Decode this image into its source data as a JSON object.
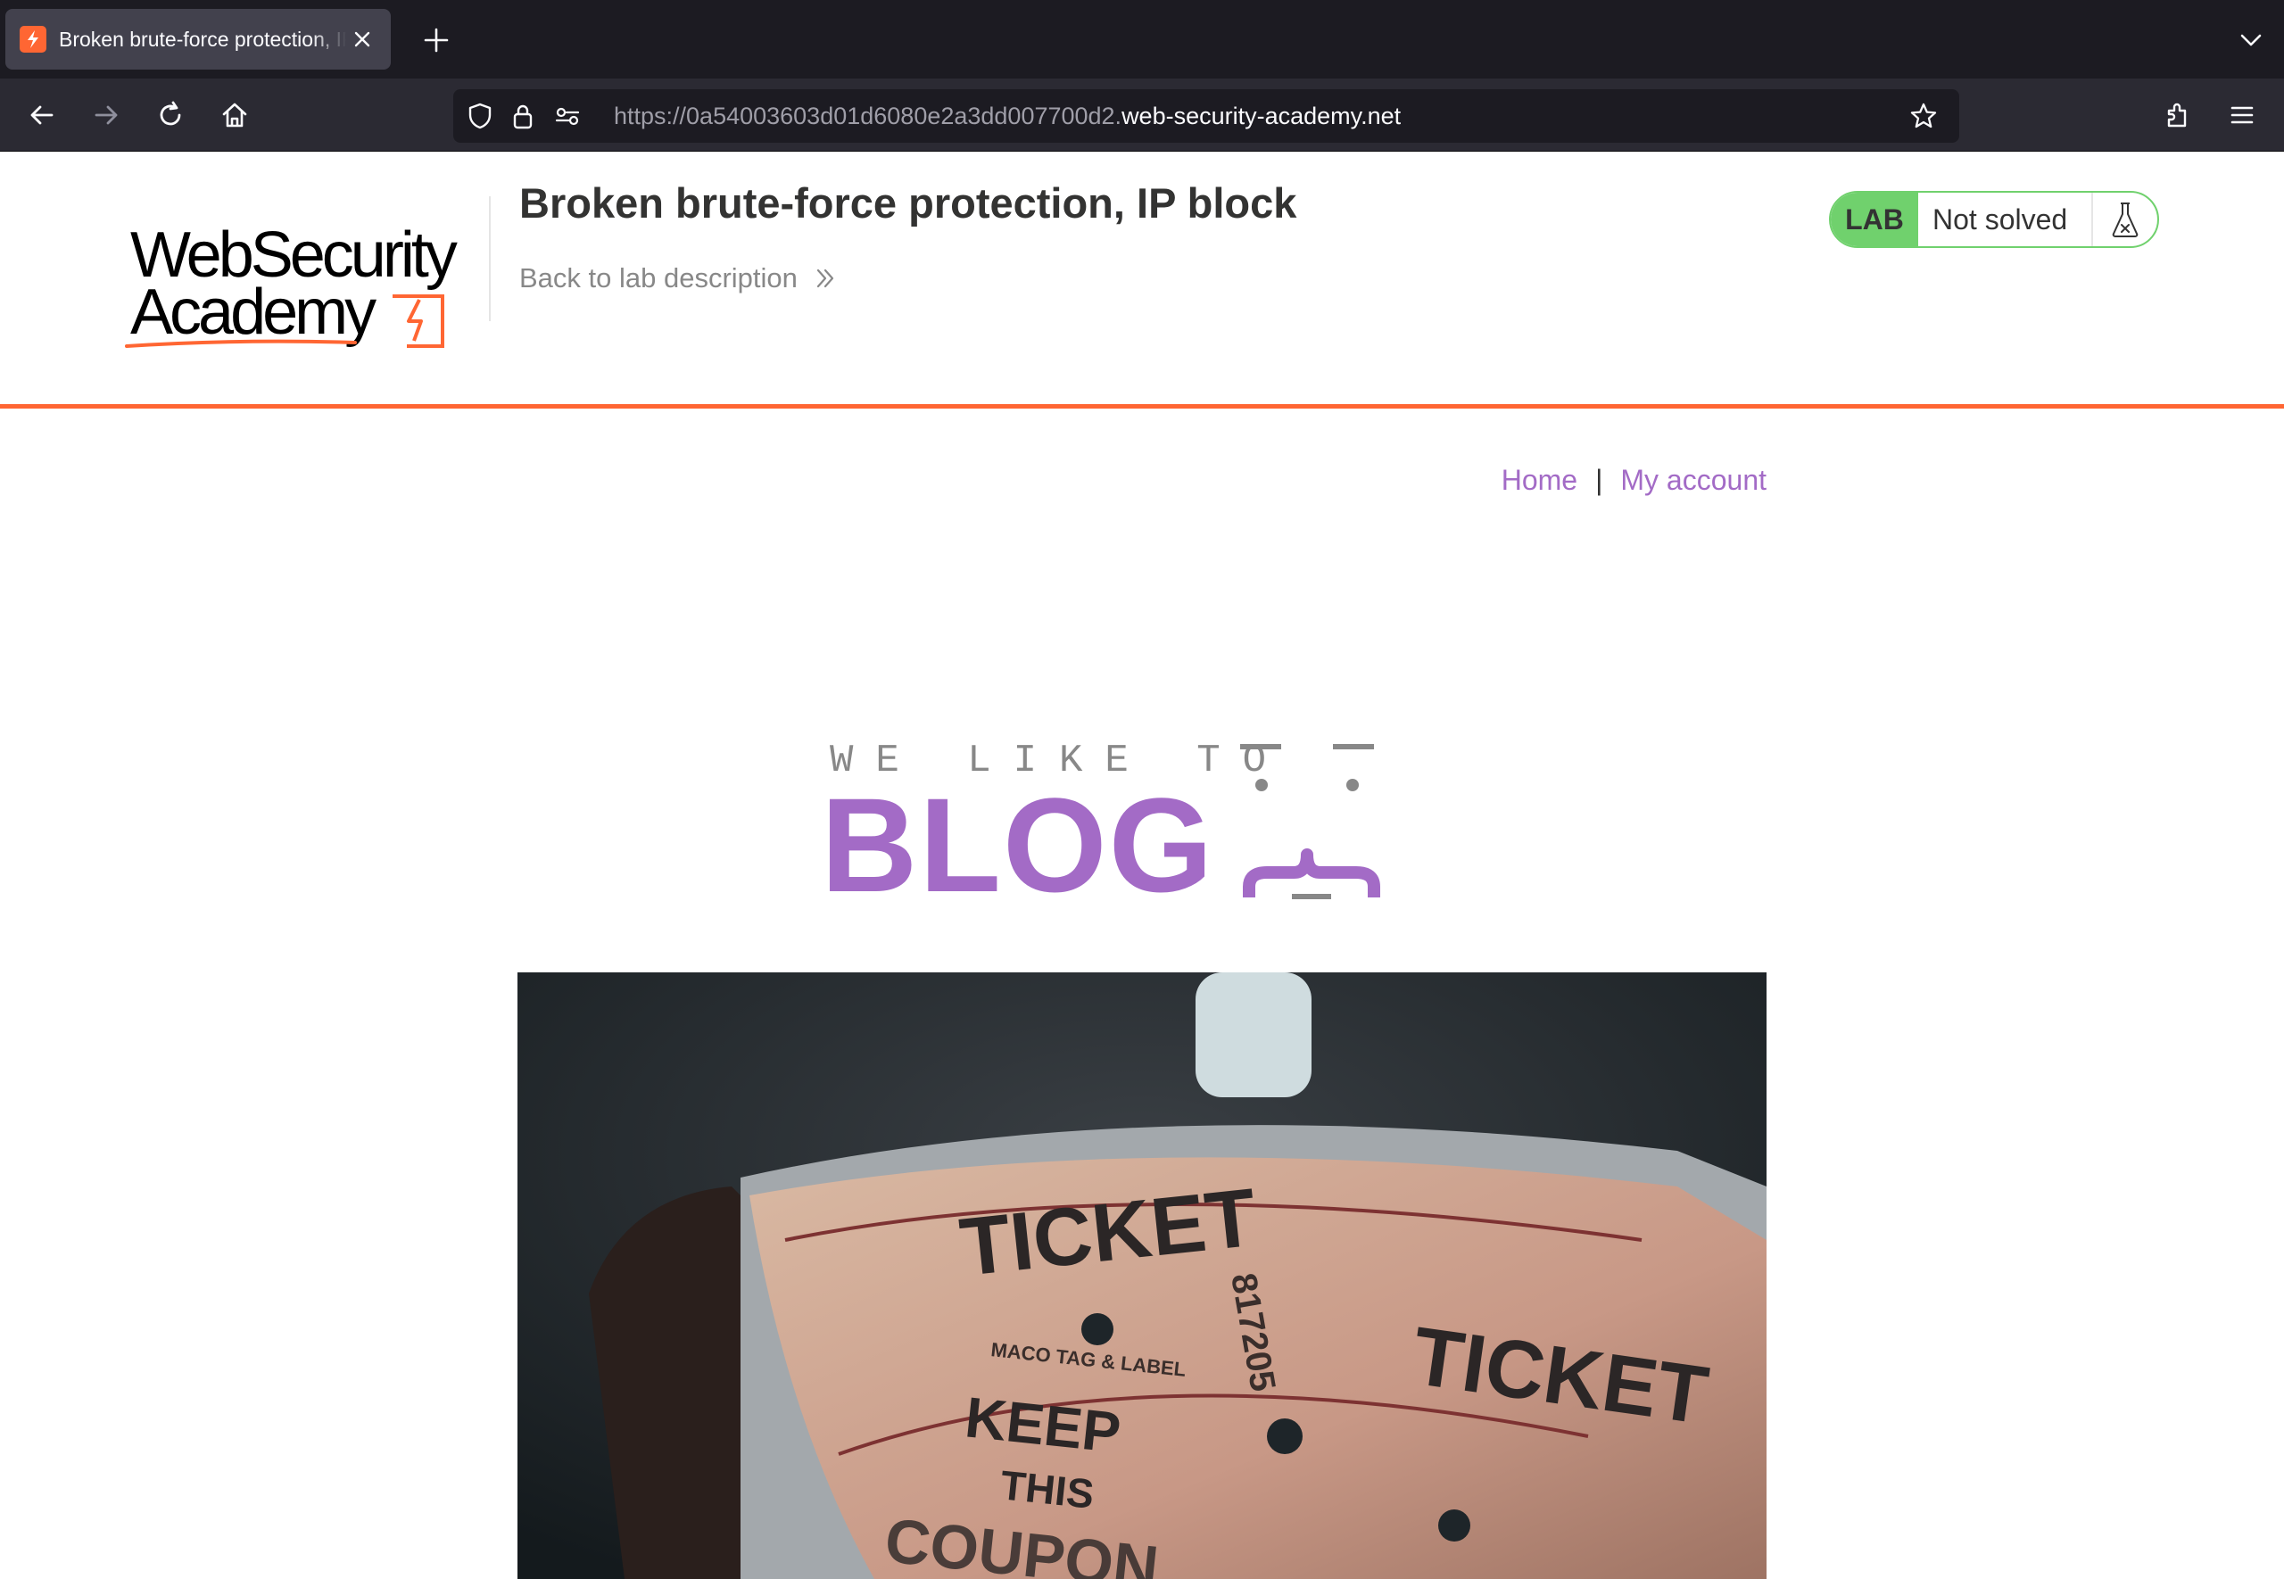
{
  "browser": {
    "tab_title": "Broken brute-force protection, IP block",
    "url_prefix": "https://0a54003603d01d6080e2a3dd007700d2.",
    "url_domain": "web-security-academy.net",
    "icons": [
      "back-icon",
      "forward-icon",
      "reload-icon",
      "home-icon",
      "shield-icon",
      "lock-icon",
      "permissions-icon",
      "bookmark-star-icon",
      "extensions-icon",
      "menu-icon",
      "new-tab-icon",
      "tab-list-icon",
      "close-icon"
    ]
  },
  "header": {
    "logo_line1": "WebSecurity",
    "logo_line2": "Academy",
    "lab_title": "Broken brute-force protection, IP block",
    "back_link": "Back to lab description",
    "lab_badge": "LAB",
    "lab_status": "Not solved"
  },
  "nav": {
    "home": "Home",
    "separator": "|",
    "my_account": "My account"
  },
  "banner": {
    "small": "WE LIKE TO",
    "big": "BLOG"
  },
  "hero_image": {
    "ticket_word": "TICKET",
    "ticket_line1": "KEEP",
    "ticket_line2": "THIS",
    "ticket_line3": "COUPON",
    "maker": "MACO TAG & LABEL",
    "serial": "817205"
  },
  "colors": {
    "accent_orange": "#ff6633",
    "link_purple": "#a36bc6",
    "lab_green": "#70d16d"
  }
}
